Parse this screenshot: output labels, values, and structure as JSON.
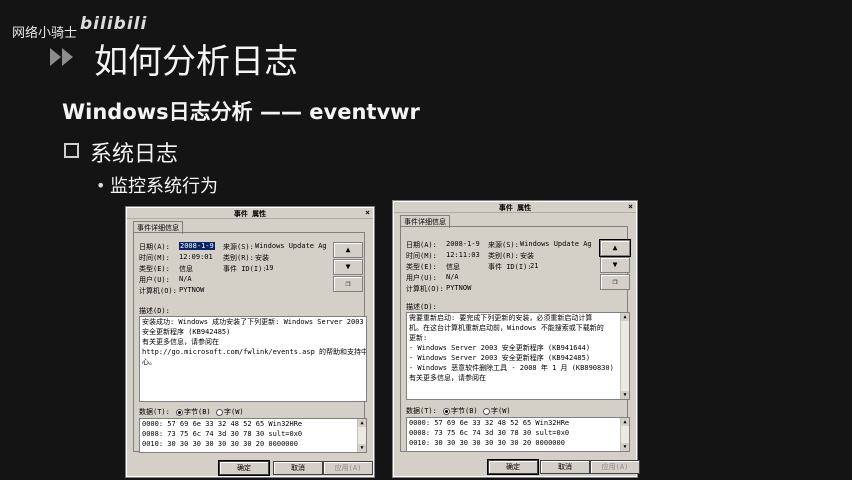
{
  "watermark": "网络小骑士",
  "logo": "bilibili",
  "title": "如何分析日志",
  "subtitle": "Windows日志分析 —— eventvwr",
  "section": "系统日志",
  "bullet": "监控系统行为",
  "dialogs": [
    {
      "title": "事件 属性",
      "tab": "事件详细信息",
      "date_label": "日期(A):",
      "date": "2008-1-9",
      "source_label": "来源(S):",
      "source": "Windows Update Ag",
      "time_label": "时间(M):",
      "time": "12:09:01",
      "category_label": "类别(R):",
      "category": "安装",
      "type_label": "类型(E):",
      "type": "信息",
      "event_id_label": "事件 ID(I):",
      "event_id": "19",
      "user_label": "用户(U):",
      "user": "N/A",
      "computer_label": "计算机(O):",
      "computer": "PYTNOW",
      "desc_label": "描述(D):",
      "desc_lines": [
        "安装成功: Windows 成功安装了下列更新: Windows Server 2003",
        "安全更新程序 (KB942485)",
        "",
        "有关更多信息，请参阅在",
        "http://go.microsoft.com/fwlink/events.asp 的帮助和支持中",
        "心。"
      ],
      "data_label": "数据(T):",
      "bytes_label": "字节(B)",
      "words_label": "字(W)",
      "data_lines": [
        "0000:  57 69 6e 33 32 48 52 65    Win32HRe",
        "0008:  73 75 6c 74 3d 30 78 30    sult=0x0",
        "0010:  30 30 30 30 30 30 30 20    0000000"
      ],
      "ok": "确定",
      "cancel": "取消",
      "apply": "应用(A)"
    },
    {
      "title": "事件 属性",
      "tab": "事件详细信息",
      "date_label": "日期(A):",
      "date": "2008-1-9",
      "source_label": "来源(S):",
      "source": "Windows Update Ag",
      "time_label": "时间(M):",
      "time": "12:11:03",
      "category_label": "类别(R):",
      "category": "安装",
      "type_label": "类型(E):",
      "type": "信息",
      "event_id_label": "事件 ID(I):",
      "event_id": "21",
      "user_label": "用户(U):",
      "user": "N/A",
      "computer_label": "计算机(O):",
      "computer": "PYTNOW",
      "desc_label": "描述(D):",
      "desc_lines": [
        "需要重新启动: 要完成下列更新的安装，必须重新启动计算",
        "机。在这台计算机重新启动前，Windows 不能搜索或下载新的",
        "更新:",
        "- Windows Server 2003 安全更新程序 (KB941644)",
        "- Windows Server 2003 安全更新程序 (KB942485)",
        "- Windows 恶意软件删除工具 - 2008 年 1 月 (KB890830)",
        "",
        "有关更多信息，请参阅在"
      ],
      "data_label": "数据(T):",
      "bytes_label": "字节(B)",
      "words_label": "字(W)",
      "data_lines": [
        "0000:  57 69 6e 33 32 48 52 65    Win32HRe",
        "0008:  73 75 6c 74 3d 30 78 30    sult=0x0",
        "0010:  30 30 30 30 30 30 30 20    0000000"
      ],
      "ok": "确定",
      "cancel": "取消",
      "apply": "应用(A)"
    }
  ]
}
